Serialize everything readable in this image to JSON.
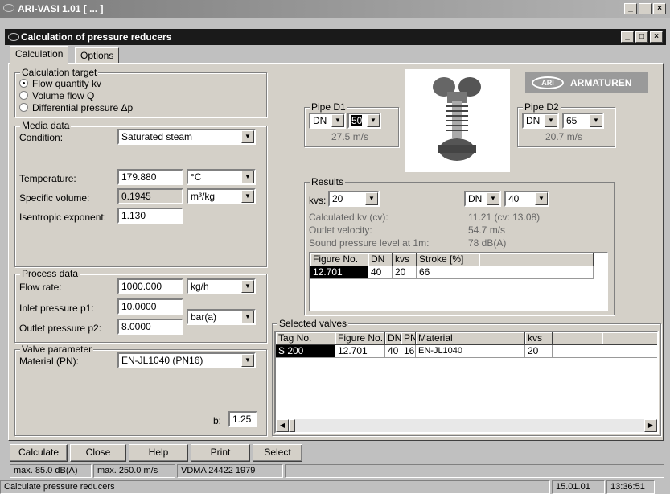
{
  "window": {
    "title": "ARI-VASI 1.01 [ ... ]"
  },
  "child_window": {
    "title": "Calculation of pressure reducers"
  },
  "tabs": [
    "Calculation",
    "Options"
  ],
  "calc_target": {
    "legend": "Calculation target",
    "options": [
      "Flow quantity kv",
      "Volume flow Q",
      "Differential pressure Δp"
    ],
    "selected_index": 0
  },
  "media": {
    "legend": "Media data",
    "condition_label": "Condition:",
    "condition_value": "Saturated steam",
    "temperature_label": "Temperature:",
    "temperature_value": "179.880",
    "temperature_unit": "°C",
    "spec_vol_label": "Specific volume:",
    "spec_vol_value": "0.1945",
    "spec_vol_unit": "m³/kg",
    "isentropic_label": "Isentropic exponent:",
    "isentropic_value": "1.130"
  },
  "process": {
    "legend": "Process data",
    "flow_label": "Flow rate:",
    "flow_value": "1000.000",
    "flow_unit": "kg/h",
    "inlet_label": "Inlet pressure p1:",
    "inlet_value": "10.0000",
    "outlet_label": "Outlet pressure p2:",
    "outlet_value": "8.0000",
    "pressure_unit": "bar(a)"
  },
  "valve": {
    "legend": "Valve parameter",
    "material_label": "Material (PN):",
    "material_value": "EN-JL1040 (PN16)",
    "b_label": "b:",
    "b_value": "1.25"
  },
  "pipe_d1": {
    "legend": "Pipe D1",
    "type": "DN",
    "size": "50",
    "velocity": "27.5 m/s"
  },
  "pipe_d2": {
    "legend": "Pipe D2",
    "type": "DN",
    "size": "65",
    "velocity": "20.7 m/s"
  },
  "brand": {
    "logo_text": "ARI",
    "name": "ARMATUREN"
  },
  "results": {
    "legend": "Results",
    "kvs_label": "kvs:",
    "kvs_value": "20",
    "dn_type": "DN",
    "dn_value": "40",
    "calc_kv_label": "Calculated kv (cv):",
    "calc_kv_value": "11.21 (cv: 13.08)",
    "outlet_vel_label": "Outlet velocity:",
    "outlet_vel_value": "54.7 m/s",
    "sound_label": "Sound pressure level at 1m:",
    "sound_value": "78 dB(A)",
    "table": {
      "headers": [
        "Figure No.",
        "DN",
        "kvs",
        "Stroke [%]"
      ],
      "rows": [
        [
          "12.701",
          "40",
          "20",
          "66"
        ]
      ]
    }
  },
  "selected_valves": {
    "legend": "Selected valves",
    "headers": [
      "Tag No.",
      "Figure No.",
      "DN",
      "PN",
      "Material",
      "kvs"
    ],
    "rows": [
      [
        "S 200",
        "12.701",
        "40",
        "16",
        "EN-JL1040",
        "20"
      ]
    ]
  },
  "buttons": {
    "calculate": "Calculate",
    "close": "Close",
    "help": "Help",
    "print": "Print",
    "select": "Select"
  },
  "status": {
    "max_db": "max. 85.0 dB(A)",
    "max_speed": "max. 250.0 m/s",
    "standard": "VDMA 24422 1979",
    "message": "Calculate pressure reducers",
    "date": "15.01.01",
    "time": "13:36:51"
  }
}
